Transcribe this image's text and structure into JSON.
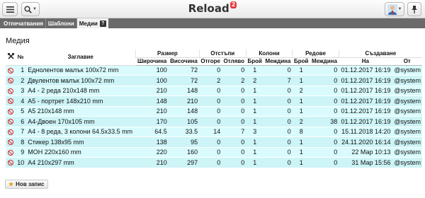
{
  "app": {
    "title": "Reload",
    "badge": "2",
    "menu_icon": "hamburger-icon",
    "search_icon": "search-icon",
    "user_icon": "user-avatar-icon",
    "pin_icon": "pin-icon"
  },
  "tabs": [
    {
      "label": "Отпечатвания",
      "active": false
    },
    {
      "label": "Шаблони",
      "active": false
    },
    {
      "label": "Медии",
      "active": true,
      "help": "?"
    }
  ],
  "section_title": "Медия",
  "table": {
    "header_top": {
      "tools_icon": "tools-icon",
      "no": "№",
      "title": "Заглавие",
      "size": "Размер",
      "margins": "Отстъпи",
      "columns": "Колони",
      "rows": "Редове",
      "created": "Създаване"
    },
    "header_sub": {
      "width": "Широчина",
      "height": "Височина",
      "top": "Отгоре",
      "left": "Отляво",
      "col_count": "Брой",
      "col_gap": "Междина",
      "row_count": "Брой",
      "row_gap": "Междина",
      "on": "На",
      "by": "От"
    },
    "rows": [
      {
        "no": "1",
        "title": "Еднолентов малък 100x72 mm",
        "width": "100",
        "height": "72",
        "top": "0",
        "left": "0",
        "cols": "1",
        "col_gap": "0",
        "rows": "1",
        "row_gap": "0",
        "on": "01.12.2017 16:19",
        "by": "@system"
      },
      {
        "no": "2",
        "title": "Двулентов малък 100x72 mm",
        "width": "100",
        "height": "72",
        "top": "2",
        "left": "2",
        "cols": "2",
        "col_gap": "7",
        "rows": "1",
        "row_gap": "0",
        "on": "01.12.2017 16:19",
        "by": "@system"
      },
      {
        "no": "3",
        "title": "A4 - 2 реда 210x148 mm",
        "width": "210",
        "height": "148",
        "top": "0",
        "left": "0",
        "cols": "1",
        "col_gap": "0",
        "rows": "2",
        "row_gap": "0",
        "on": "01.12.2017 16:19",
        "by": "@system"
      },
      {
        "no": "4",
        "title": "A5 - портрет 148x210 mm",
        "width": "148",
        "height": "210",
        "top": "0",
        "left": "0",
        "cols": "1",
        "col_gap": "0",
        "rows": "1",
        "row_gap": "0",
        "on": "01.12.2017 16:19",
        "by": "@system"
      },
      {
        "no": "5",
        "title": "A5 210x148 mm",
        "width": "210",
        "height": "148",
        "top": "0",
        "left": "0",
        "cols": "1",
        "col_gap": "0",
        "rows": "1",
        "row_gap": "0",
        "on": "01.12.2017 16:19",
        "by": "@system"
      },
      {
        "no": "6",
        "title": "A4-Двоен 170x105 mm",
        "width": "170",
        "height": "105",
        "top": "0",
        "left": "0",
        "cols": "1",
        "col_gap": "0",
        "rows": "2",
        "row_gap": "38",
        "on": "01.12.2017 16:19",
        "by": "@system"
      },
      {
        "no": "7",
        "title": "A4 - 8 реда, 3 колони 64.5x33.5 mm",
        "width": "64.5",
        "height": "33.5",
        "top": "14",
        "left": "7",
        "cols": "3",
        "col_gap": "0",
        "rows": "8",
        "row_gap": "0",
        "on": "15.11.2018 14:20",
        "by": "@system"
      },
      {
        "no": "8",
        "title": "Стикер 138x95 mm",
        "width": "138",
        "height": "95",
        "top": "0",
        "left": "0",
        "cols": "1",
        "col_gap": "0",
        "rows": "1",
        "row_gap": "0",
        "on": "24.11.2020 16:14",
        "by": "@system"
      },
      {
        "no": "9",
        "title": "MOH 220x160 mm",
        "width": "220",
        "height": "160",
        "top": "0",
        "left": "0",
        "cols": "1",
        "col_gap": "0",
        "rows": "1",
        "row_gap": "0",
        "on": "22 Мар 10:13",
        "by": "@system"
      },
      {
        "no": "10",
        "title": "A4 210x297 mm",
        "width": "210",
        "height": "297",
        "top": "0",
        "left": "0",
        "cols": "1",
        "col_gap": "0",
        "rows": "1",
        "row_gap": "0",
        "on": "31 Мар 15:56",
        "by": "@system"
      }
    ]
  },
  "new_record_label": "Нов запис",
  "colors": {
    "row_bg": "#d9fbfd",
    "tab_bar": "#6a6a6a",
    "delete_icon": "#dd2222",
    "badge": "#e5393b"
  }
}
